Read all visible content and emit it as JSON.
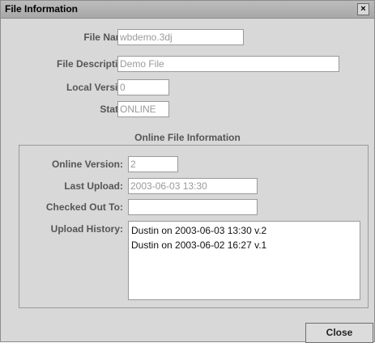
{
  "window": {
    "title": "File Information",
    "close_glyph": "×"
  },
  "fields": {
    "file_name": {
      "label": "File Name:",
      "value": "wbdemo.3dj"
    },
    "file_description": {
      "label": "File Description:",
      "value": "Demo File"
    },
    "local_version": {
      "label": "Local Version:",
      "value": "0"
    },
    "status": {
      "label": "Status:",
      "value": "ONLINE"
    }
  },
  "online": {
    "section_title": "Online File Information",
    "online_version": {
      "label": "Online Version:",
      "value": "2"
    },
    "last_upload": {
      "label": "Last Upload:",
      "value": "2003-06-03 13:30"
    },
    "checked_out_to": {
      "label": "Checked Out To:",
      "value": ""
    },
    "upload_history": {
      "label": "Upload History:",
      "items": [
        "Dustin on 2003-06-03 13:30 v.2",
        "Dustin on 2003-06-02 16:27 v.1"
      ]
    }
  },
  "buttons": {
    "close_label": "Close"
  }
}
